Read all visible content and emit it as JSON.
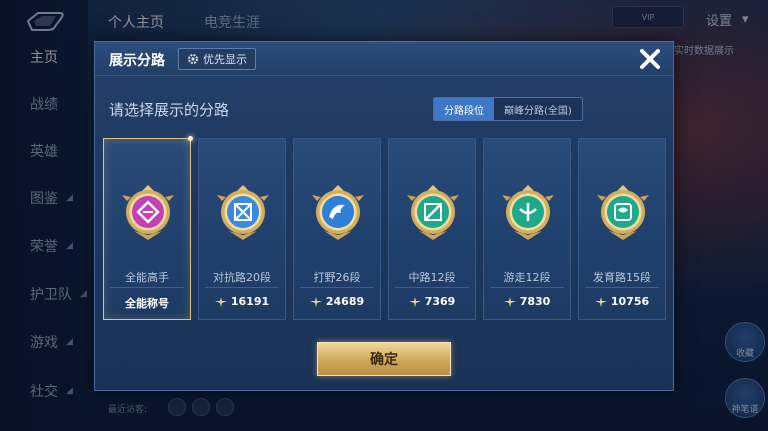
{
  "background": {
    "top_tabs": [
      "个人主页",
      "电竞生涯"
    ],
    "settings_label": "设置",
    "note": "实时数据展示",
    "nav_items": [
      {
        "label": "主页",
        "has_arrow": false
      },
      {
        "label": "战绩",
        "has_arrow": false
      },
      {
        "label": "英雄",
        "has_arrow": false
      },
      {
        "label": "图鉴",
        "has_arrow": true
      },
      {
        "label": "荣誉",
        "has_arrow": true
      },
      {
        "label": "护卫队",
        "has_arrow": true
      },
      {
        "label": "游戏",
        "has_arrow": true
      },
      {
        "label": "社交",
        "has_arrow": true
      }
    ],
    "recent_label": "最近访客:",
    "side_buttons": [
      "收藏",
      "神笔谱"
    ]
  },
  "modal": {
    "title": "展示分路",
    "priority_label": "优先显示",
    "subtitle": "请选择展示的分路",
    "segment": {
      "options": [
        "分路段位",
        "巅峰分路(全国)"
      ],
      "selected": 0
    },
    "cards": [
      {
        "name": "全能高手",
        "score": "全能称号",
        "show_icon": false,
        "selected": true,
        "emblem": "all-round",
        "color": "#c23fb6"
      },
      {
        "name": "对抗路20段",
        "score": "16191",
        "show_icon": true,
        "selected": false,
        "emblem": "clash",
        "color": "#3a8be0"
      },
      {
        "name": "打野26段",
        "score": "24689",
        "show_icon": true,
        "selected": false,
        "emblem": "jungle",
        "color": "#2f7fd6"
      },
      {
        "name": "中路12段",
        "score": "7369",
        "show_icon": true,
        "selected": false,
        "emblem": "mid",
        "color": "#1fa88a"
      },
      {
        "name": "游走12段",
        "score": "7830",
        "show_icon": true,
        "selected": false,
        "emblem": "roam",
        "color": "#1fa88a"
      },
      {
        "name": "发育路15段",
        "score": "10756",
        "show_icon": true,
        "selected": false,
        "emblem": "farm",
        "color": "#1fa88a"
      }
    ],
    "confirm_label": "确定"
  },
  "colors": {
    "accent_blue": "#3f78c4",
    "gold": "#e1c27a",
    "panel": "#1d375e"
  }
}
